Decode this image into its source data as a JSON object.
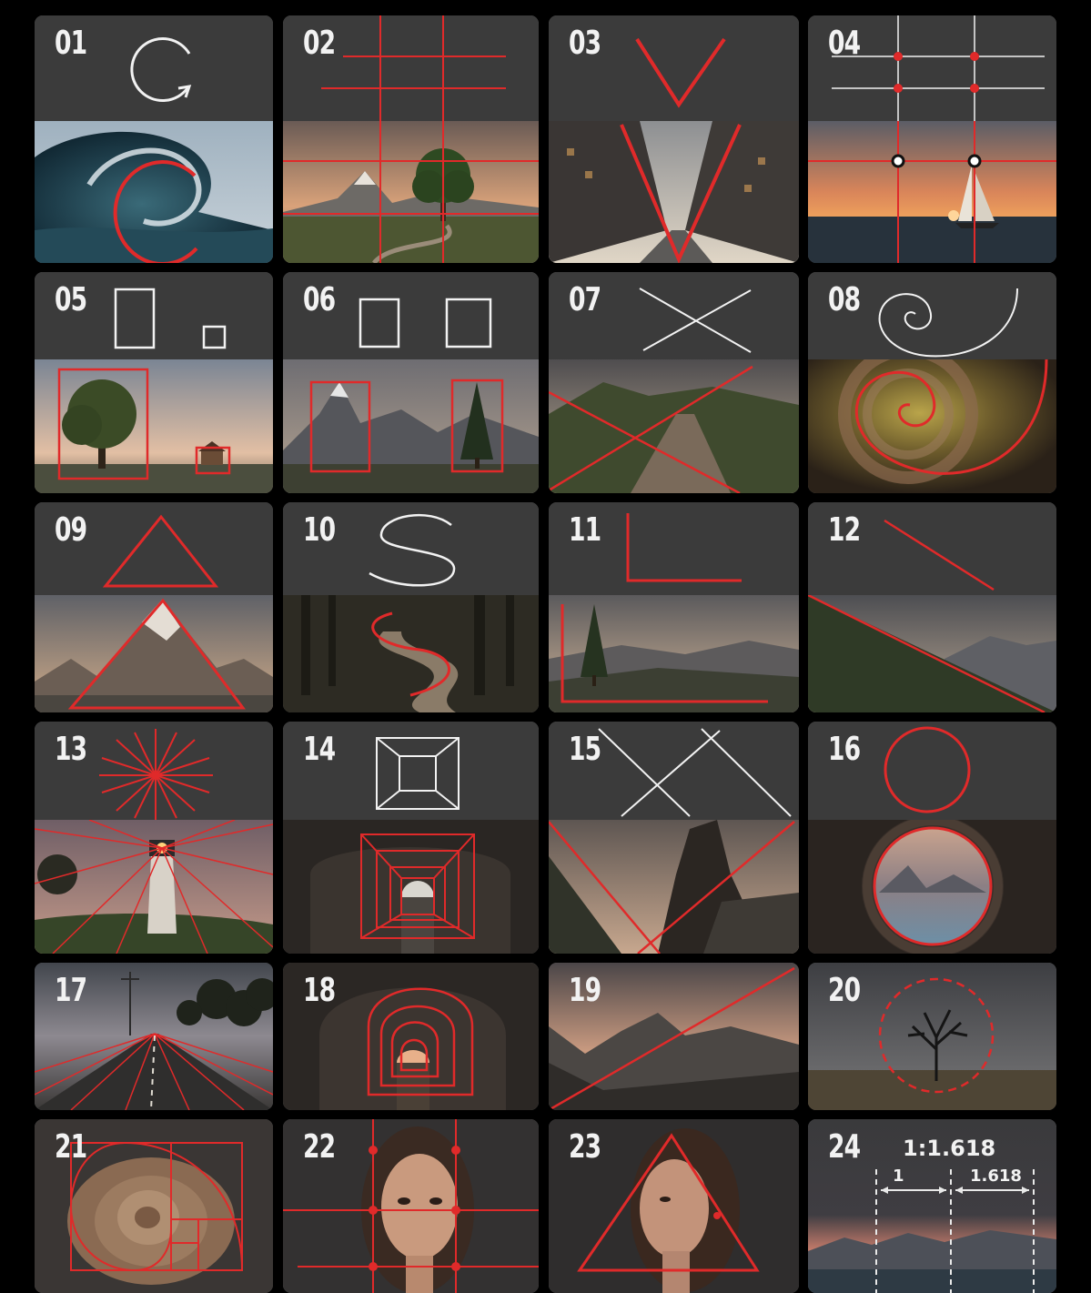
{
  "colors": {
    "background": "#000000",
    "panel": "#3b3b3b",
    "guide_red": "#e02a2a",
    "icon_white": "#f2f2f2"
  },
  "cards": [
    {
      "number": "01",
      "icon": "curved-arrow-icon",
      "photo": "ocean-wave"
    },
    {
      "number": "02",
      "icon": "thirds-grid-icon",
      "photo": "mountain-tree-road"
    },
    {
      "number": "03",
      "icon": "v-lines-icon",
      "photo": "city-street"
    },
    {
      "number": "04",
      "icon": "grid-points-icon",
      "photo": "sunset-sailboat"
    },
    {
      "number": "05",
      "icon": "size-contrast-icon",
      "photo": "tree-and-house"
    },
    {
      "number": "06",
      "icon": "balance-squares-icon",
      "photo": "mountain-and-pine"
    },
    {
      "number": "07",
      "icon": "cross-lines-icon",
      "photo": "country-road"
    },
    {
      "number": "08",
      "icon": "spiral-icon",
      "photo": "spiral-staircase"
    },
    {
      "number": "09",
      "icon": "triangle-icon",
      "photo": "mountain-peak"
    },
    {
      "number": "10",
      "icon": "s-curve-icon",
      "photo": "forest-path"
    },
    {
      "number": "11",
      "icon": "l-shape-icon",
      "photo": "pine-valley"
    },
    {
      "number": "12",
      "icon": "diagonal-line-icon",
      "photo": "hillside"
    },
    {
      "number": "13",
      "icon": "radial-burst-icon",
      "photo": "lighthouse"
    },
    {
      "number": "14",
      "icon": "tunnel-frame-icon",
      "photo": "tunnel"
    },
    {
      "number": "15",
      "icon": "double-diagonal-icon",
      "photo": "rock-arch"
    },
    {
      "number": "16",
      "icon": "circle-icon",
      "photo": "cave-window"
    },
    {
      "number": "17",
      "icon": "",
      "photo": "long-road"
    },
    {
      "number": "18",
      "icon": "",
      "photo": "stone-tunnel"
    },
    {
      "number": "19",
      "icon": "",
      "photo": "mountain-diagonal"
    },
    {
      "number": "20",
      "icon": "",
      "photo": "lone-tree"
    },
    {
      "number": "21",
      "icon": "",
      "photo": "nautilus-shell"
    },
    {
      "number": "22",
      "icon": "",
      "photo": "portrait-grid"
    },
    {
      "number": "23",
      "icon": "",
      "photo": "portrait-triangle"
    },
    {
      "number": "24",
      "icon": "",
      "photo": "golden-ratio-landscape",
      "ratio_label": "1:1.618",
      "segment_a_label": "1",
      "segment_b_label": "1.618"
    }
  ]
}
